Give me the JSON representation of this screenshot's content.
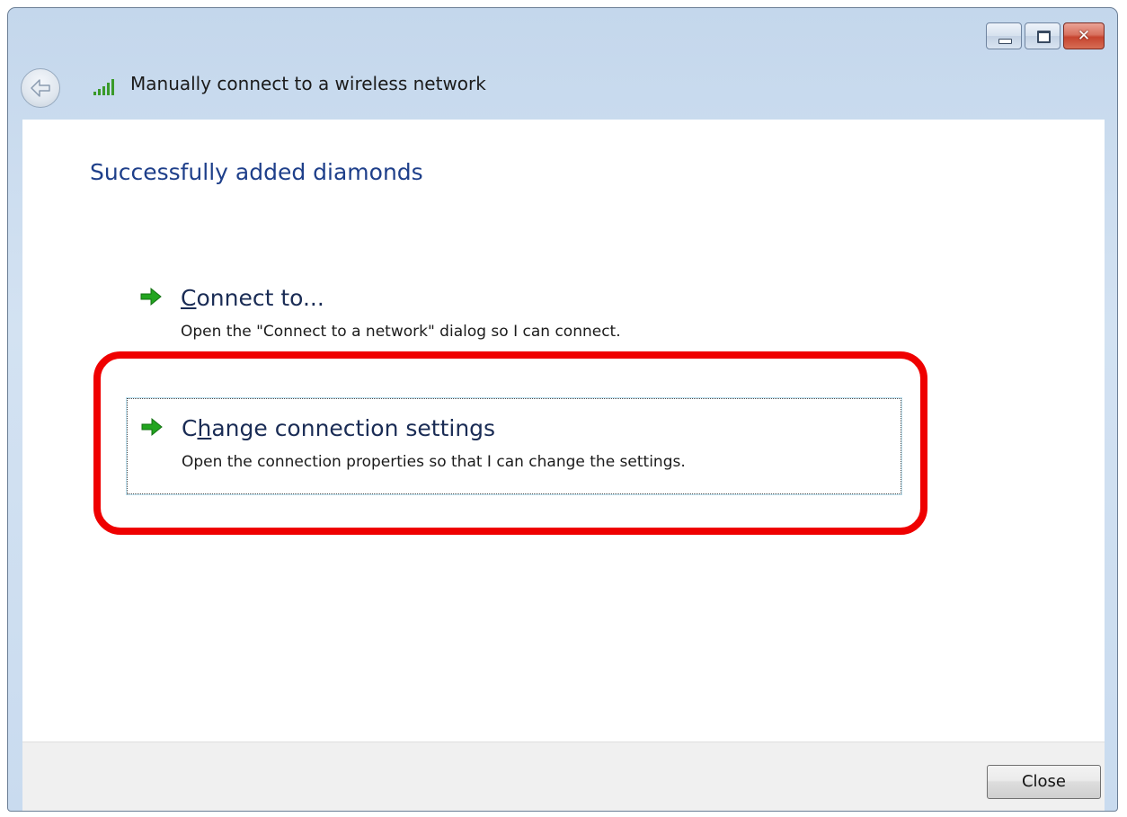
{
  "window": {
    "title": "Manually connect to a wireless network",
    "controls": {
      "minimize": "minimize",
      "maximize": "maximize",
      "close": "✕"
    }
  },
  "content": {
    "heading": "Successfully added diamonds",
    "commands": [
      {
        "title_prefix": "",
        "title_access_key": "C",
        "title_rest": "onnect to...",
        "description": "Open the \"Connect to a network\" dialog so I can connect."
      },
      {
        "title_prefix": "C",
        "title_access_key": "h",
        "title_rest": "ange connection settings",
        "description": "Open the connection properties so that I can change the settings."
      }
    ]
  },
  "footer": {
    "close_label": "Close"
  },
  "colors": {
    "heading": "#1e3f8a",
    "highlight": "#ef0000",
    "arrow": "#22a51f"
  },
  "icons": {
    "back": "back-arrow-icon",
    "signal": "wireless-signal-icon",
    "command": "green-arrow-icon"
  }
}
